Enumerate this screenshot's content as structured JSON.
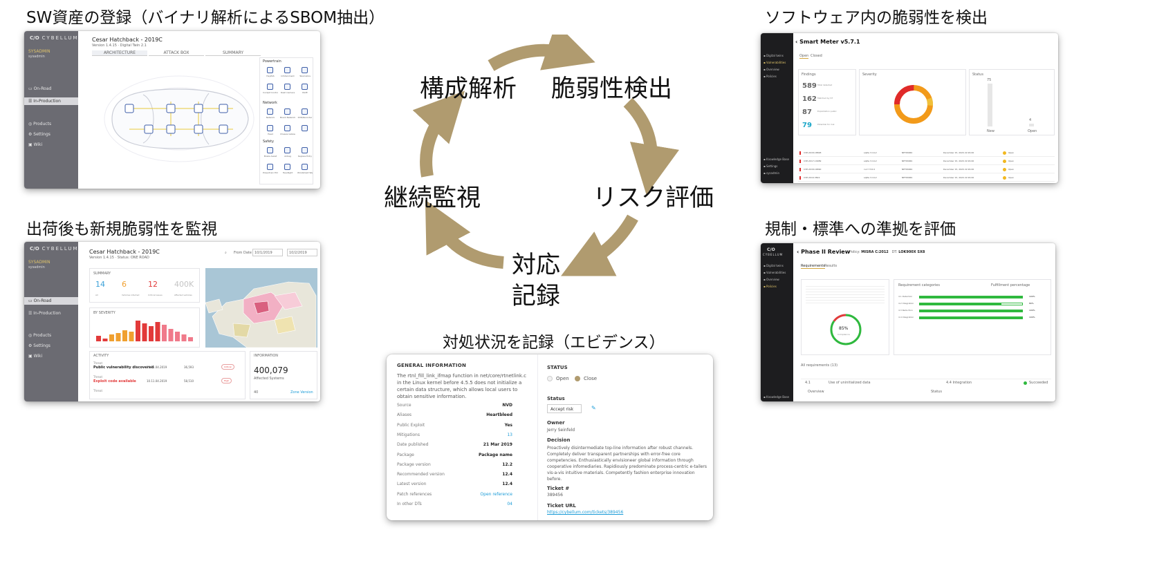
{
  "captions": {
    "sbom": "SW資産の登録（バイナリ解析によるSBOM抽出）",
    "monitor": "出荷後も新規脆弱性を監視",
    "detect": "ソフトウェア内の脆弱性を検出",
    "compliance": "規制・標準への準拠を評価",
    "evidence": "対処状況を記録（エビデンス）"
  },
  "cycle": {
    "step1": "構成解析",
    "step2": "脆弱性検出",
    "step3": "リスク評価",
    "step4_line1": "対応",
    "step4_line2": "記録",
    "step5": "継続監視",
    "arrow_color": "#b09b6f"
  },
  "shot_sbom": {
    "logo_mark": "C/O",
    "logo_text": "CYBELLUM",
    "user_name": "SYSADMIN",
    "user_sub": "sysadmin",
    "nav": [
      "On-Road",
      "In-Production",
      "Products",
      "Settings",
      "Wiki"
    ],
    "title": "Cesar Hatchback - 2019C",
    "subtitle": "Version 1.4.15 · Digital Twin 2.1",
    "tabs": [
      "ARCHITECTURE",
      "ATTACK BOX",
      "SUMMARY"
    ],
    "groups": [
      "Powertrain",
      "Network",
      "Safety"
    ],
    "modules": [
      [
        "HeyPAS",
        "Infotainment",
        "Telematics",
        "Cockpit Controller",
        "Dash Camera",
        "PAVE"
      ],
      [
        "Network",
        "Board Network",
        "DVR/Recorder",
        "Head",
        "Chassis Gateway",
        ""
      ],
      [
        "Brake Assist",
        "Airbag",
        "Keyless Entry",
        "Powertrain ECU",
        "Headlight",
        "Windshield Wiper"
      ]
    ]
  },
  "shot_monitor": {
    "logo_mark": "C/O",
    "logo_text": "CYBELLUM",
    "user_name": "SYSADMIN",
    "user_sub": "sysadmin",
    "nav": [
      "On-Road",
      "In-Production",
      "Products",
      "Settings",
      "Wiki"
    ],
    "title": "Cesar Hatchback - 2019C",
    "subtitle": "Version 1.4.15 · Status: ONE ROAD",
    "from_label": "From Date",
    "date_from": "10/1/2019",
    "date_to": "10/2/2019",
    "summary_label": "SUMMARY",
    "summary": [
      {
        "value": "14",
        "label": "All",
        "color": "#3aa0d8"
      },
      {
        "value": "6",
        "label": "Vehicles infected",
        "color": "#f0a030"
      },
      {
        "value": "12",
        "label": "Critical issues",
        "color": "#e23a3a"
      },
      {
        "value": "400K",
        "label": "Affected vehicles",
        "color": "#c4c4c4"
      }
    ],
    "severity_label": "BY SEVERITY",
    "activity_label": "ACTIVITY",
    "activity": [
      {
        "kind": "Threat",
        "title": "Public vulnerability discovered",
        "time": "11.11.04.2019",
        "devices": "36,593",
        "badge": "Critical"
      },
      {
        "kind": "Threat",
        "title": "Exploit code available",
        "time": "10.11.04.2019",
        "devices": "58,510",
        "badge": "High"
      },
      {
        "kind": "Threat",
        "title": "",
        "time": "",
        "devices": "",
        "badge": ""
      }
    ],
    "info_label": "INFORMATION",
    "info_value": "400,079",
    "info_sub": "Affected Systems",
    "info_value2": "40",
    "info_link": "Zone Version"
  },
  "shot_detect": {
    "title": "Smart Meter v5.7.1",
    "tabs": [
      "Open",
      "Closed"
    ],
    "nav": [
      "Digital twins",
      "Vulnerabilities",
      "Overview",
      "Policies",
      "Knowledge Base",
      "Settings",
      "sysadmin"
    ],
    "findings_label": "Findings",
    "findings": [
      {
        "value": "589",
        "label": "Total detected",
        "color": "#666"
      },
      {
        "value": "162",
        "label": "Matched by ST",
        "color": "#666"
      },
      {
        "value": "87",
        "label": "Exploitation public",
        "color": "#666"
      },
      {
        "value": "79",
        "label": "Potential for risk",
        "color": "#1aa6c8"
      }
    ],
    "severity_label": "Severity",
    "status_label": "Status",
    "status_values": [
      {
        "value": "75",
        "label": "New"
      },
      {
        "value": "4",
        "label": "Open"
      }
    ],
    "table": [
      {
        "cve": "CVE-2018-18848",
        "pkg": "sqlite 3.14.2",
        "vector": "NETWORK",
        "date": "December 15, 2020 22:29:00",
        "status": "Open"
      },
      {
        "cve": "CVE-2017-10989",
        "pkg": "sqlite 3.14.2",
        "vector": "NETWORK",
        "date": "December 15, 2020 22:29:00",
        "status": "Open"
      },
      {
        "cve": "CVE-2018-16890",
        "pkg": "curl 7.52.0",
        "vector": "NETWORK",
        "date": "December 15, 2020 22:29:00",
        "status": "Open"
      },
      {
        "cve": "CVE-2019-3822",
        "pkg": "sqlite 3.14.2",
        "vector": "NETWORK",
        "date": "December 15, 2020 22:29:00",
        "status": "Open"
      }
    ]
  },
  "shot_compliance": {
    "logo_mark": "C/O",
    "logo_text": "CYBELLUM",
    "title": "Phase II Review",
    "policy_label": "Policy:",
    "policy": "MISRA C:2012",
    "dt_label": "DT:",
    "dt": "LOK900X SX8",
    "tabs": [
      "Requirements",
      "Results"
    ],
    "nav": [
      "Digital twins",
      "Vulnerabilities",
      "Overview",
      "Policies",
      "Knowledge Base"
    ],
    "gauge_value": "85%",
    "gauge_label": "Compliance",
    "req_label": "Requirement categories",
    "fulfil_label": "Fulfillment percentage",
    "categories": [
      {
        "name": "4.1 Detection",
        "value": 100
      },
      {
        "name": "4.2 Integration",
        "value": 80
      },
      {
        "name": "4.3 Reduction",
        "value": 100
      },
      {
        "name": "4.4 Integration",
        "value": 100
      }
    ],
    "all_req": "All requirements (13)",
    "row_id": "4.1",
    "row_text": "Use of uninitialized data",
    "row_cat": "4.4 Integration",
    "row_status": "Succeeded",
    "overview_tab": "Overview",
    "status_tab": "Status"
  },
  "shot_evidence": {
    "general_label": "GENERAL INFORMATION",
    "description": "The rtnl_fill_link_ifmap function in net/core/rtnetlink.c in the Linux kernel before 4.5.5 does not initialize a certain data structure, which allows local users to obtain sensitive information.",
    "fields": [
      {
        "k": "Source",
        "v": "NVD",
        "link": false
      },
      {
        "k": "Aliases",
        "v": "Heartbleed",
        "link": false
      },
      {
        "k": "Public Exploit",
        "v": "Yes",
        "link": false
      },
      {
        "k": "Mitigations",
        "v": "13",
        "link": true
      },
      {
        "k": "Date published",
        "v": "21 Mar 2019",
        "link": false
      },
      {
        "k": "Package",
        "v": "Package name",
        "link": false
      },
      {
        "k": "Package version",
        "v": "12.2",
        "link": false
      },
      {
        "k": "Recommended version",
        "v": "12.4",
        "link": false
      },
      {
        "k": "Latest version",
        "v": "12.4",
        "link": false
      },
      {
        "k": "Patch references",
        "v": "Open reference",
        "link": true
      },
      {
        "k": "In other DTs",
        "v": "04",
        "link": true
      }
    ],
    "status_label": "STATUS",
    "opt_open": "Open",
    "opt_close": "Close",
    "status_field": "Status",
    "status_value": "Accept risk",
    "owner_label": "Owner",
    "owner": "Jerry Seinfeld",
    "decision_label": "Decision",
    "decision": "Proactively disintermediate top-line information after robust channels. Completely deliver transparent partnerships with error-free core competencies. Enthusiastically envisioneer global information through cooperative infomediaries. Rapidiously predominate process-centric e-tailers vis-a-vis intuitive materials. Competently fashion enterprise innovation before.",
    "ticket_label": "Ticket #",
    "ticket": "389456",
    "url_label": "Ticket URL",
    "url": "https://cybellum.com/tickets/389456"
  }
}
